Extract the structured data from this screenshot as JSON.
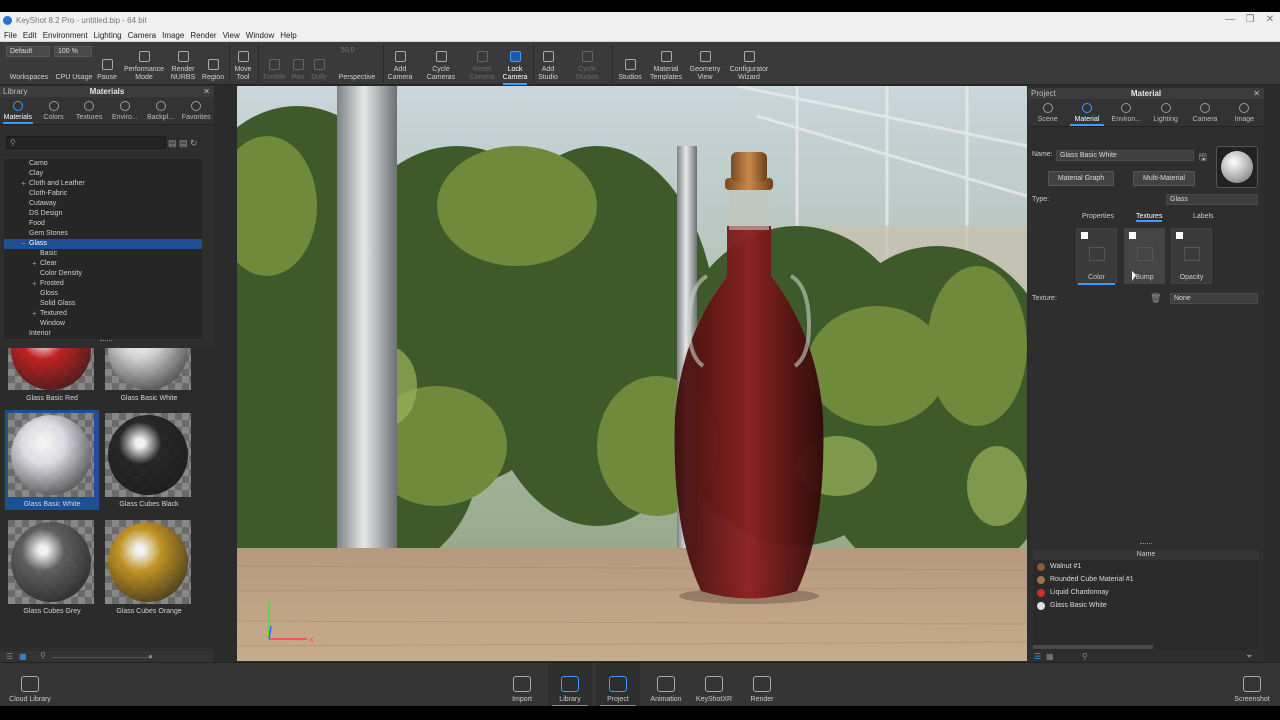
{
  "window": {
    "title": "KeyShot 8.2 Pro  - untitled.bip  - 64 bit",
    "minimize_glyph": "—",
    "restore_glyph": "❐",
    "close_glyph": "✕"
  },
  "menu": [
    "File",
    "Edit",
    "Environment",
    "Lighting",
    "Camera",
    "Image",
    "Render",
    "View",
    "Window",
    "Help"
  ],
  "toolbar": {
    "workspace_value": "Default",
    "cpu_value": "100 %",
    "perspective_value": "50,0",
    "items": [
      {
        "label1": "Workspaces",
        "label2": "",
        "icon": "workspaces-icon"
      },
      {
        "label1": "CPU Usage",
        "label2": "",
        "icon": "cpu-icon"
      },
      {
        "label1": "Pause",
        "label2": "",
        "icon": "pause-icon"
      },
      {
        "label1": "Performance",
        "label2": "Mode",
        "icon": "performance-icon"
      },
      {
        "label1": "Render",
        "label2": "NURBS",
        "icon": "nurbs-icon"
      },
      {
        "label1": "Region",
        "label2": "",
        "icon": "region-icon"
      },
      {
        "label1": "Move",
        "label2": "Tool",
        "icon": "move-icon"
      },
      {
        "label1": "Tumble",
        "label2": "",
        "icon": "tumble-icon"
      },
      {
        "label1": "Pan",
        "label2": "",
        "icon": "pan-icon"
      },
      {
        "label1": "Dolly",
        "label2": "",
        "icon": "dolly-icon"
      },
      {
        "label1": "Perspective",
        "label2": "",
        "icon": "perspective-icon"
      },
      {
        "label1": "Add",
        "label2": "Camera",
        "icon": "add-camera-icon"
      },
      {
        "label1": "Cycle",
        "label2": "Cameras",
        "icon": "cycle-cameras-icon"
      },
      {
        "label1": "Reset",
        "label2": "Camera",
        "icon": "reset-camera-icon"
      },
      {
        "label1": "Lock",
        "label2": "Camera",
        "icon": "lock-camera-icon"
      },
      {
        "label1": "Add",
        "label2": "Studio",
        "icon": "add-studio-icon"
      },
      {
        "label1": "Cycle",
        "label2": "Studios",
        "icon": "cycle-studios-icon"
      },
      {
        "label1": "Studios",
        "label2": "",
        "icon": "studios-icon"
      },
      {
        "label1": "Material",
        "label2": "Templates",
        "icon": "material-templates-icon"
      },
      {
        "label1": "Geometry",
        "label2": "View",
        "icon": "geometry-view-icon"
      },
      {
        "label1": "Configurator",
        "label2": "Wizard",
        "icon": "configurator-icon"
      }
    ]
  },
  "library": {
    "header_left": "Library",
    "header_title": "Materials",
    "tabs": [
      "Materials",
      "Colors",
      "Textures",
      "Enviro...",
      "Backpl...",
      "Favorites"
    ],
    "tree": [
      {
        "label": "Camo",
        "level": 0,
        "expand": ""
      },
      {
        "label": "Clay",
        "level": 0,
        "expand": ""
      },
      {
        "label": "Cloth and Leather",
        "level": 0,
        "expand": "+"
      },
      {
        "label": "Cloth-Fabric",
        "level": 0,
        "expand": ""
      },
      {
        "label": "Cutaway",
        "level": 0,
        "expand": ""
      },
      {
        "label": "DS Design",
        "level": 0,
        "expand": ""
      },
      {
        "label": "Food",
        "level": 0,
        "expand": ""
      },
      {
        "label": "Gem Stones",
        "level": 0,
        "expand": ""
      },
      {
        "label": "Glass",
        "level": 0,
        "expand": "−",
        "selected": true
      },
      {
        "label": "Basic",
        "level": 1,
        "expand": ""
      },
      {
        "label": "Clear",
        "level": 1,
        "expand": "+"
      },
      {
        "label": "Color Density",
        "level": 1,
        "expand": ""
      },
      {
        "label": "Frosted",
        "level": 1,
        "expand": "+"
      },
      {
        "label": "Gloss",
        "level": 1,
        "expand": ""
      },
      {
        "label": "Solid Glass",
        "level": 1,
        "expand": ""
      },
      {
        "label": "Textured",
        "level": 1,
        "expand": "+"
      },
      {
        "label": "Window",
        "level": 1,
        "expand": ""
      },
      {
        "label": "Interior",
        "level": 0,
        "expand": ""
      }
    ],
    "swatches": [
      {
        "name": "Glass Basic Red",
        "color": "#c81818"
      },
      {
        "name": "Glass Basic White",
        "color": "#d8d8d8"
      },
      {
        "name": "Glass Basic White",
        "color": "#e6e6ee",
        "selected": true
      },
      {
        "name": "Glass Cubes Black",
        "color": "#1e1e1e"
      },
      {
        "name": "Glass Cubes Grey",
        "color": "#5c5c5c"
      },
      {
        "name": "Glass Cubes Orange",
        "color": "#c8961a"
      }
    ]
  },
  "project": {
    "header_left": "Project",
    "header_title": "Material",
    "tabs": [
      "Scene",
      "Material",
      "Environ...",
      "Lighting",
      "Camera",
      "Image"
    ],
    "name_label": "Name:",
    "name_value": "Glass Basic White",
    "material_graph": "Material Graph",
    "multi_material": "Multi-Material",
    "type_label": "Type:",
    "type_value": "Glass",
    "subtabs": [
      "Properties",
      "Textures",
      "Labels"
    ],
    "texture_slots": [
      "Color",
      "Bump",
      "Opacity"
    ],
    "texture_label": "Texture:",
    "texture_value": "None",
    "list_header": "Name",
    "materials": [
      {
        "name": "Walnut #1",
        "color": "#8a5a32"
      },
      {
        "name": "Rounded Cube Material #1",
        "color": "#9a7448"
      },
      {
        "name": "Liquid Chardonnay",
        "color": "#c83030"
      },
      {
        "name": "Glass Basic White",
        "color": "#e0e0e0"
      }
    ]
  },
  "bottom": [
    {
      "label": "Cloud Library",
      "icon": "cloud-library-icon"
    },
    {
      "label": "Import",
      "icon": "import-icon"
    },
    {
      "label": "Library",
      "icon": "library-icon"
    },
    {
      "label": "Project",
      "icon": "project-icon"
    },
    {
      "label": "Animation",
      "icon": "animation-icon"
    },
    {
      "label": "KeyShotXR",
      "icon": "keyshotxr-icon"
    },
    {
      "label": "Render",
      "icon": "render-icon"
    },
    {
      "label": "Screenshot",
      "icon": "screenshot-icon"
    }
  ]
}
